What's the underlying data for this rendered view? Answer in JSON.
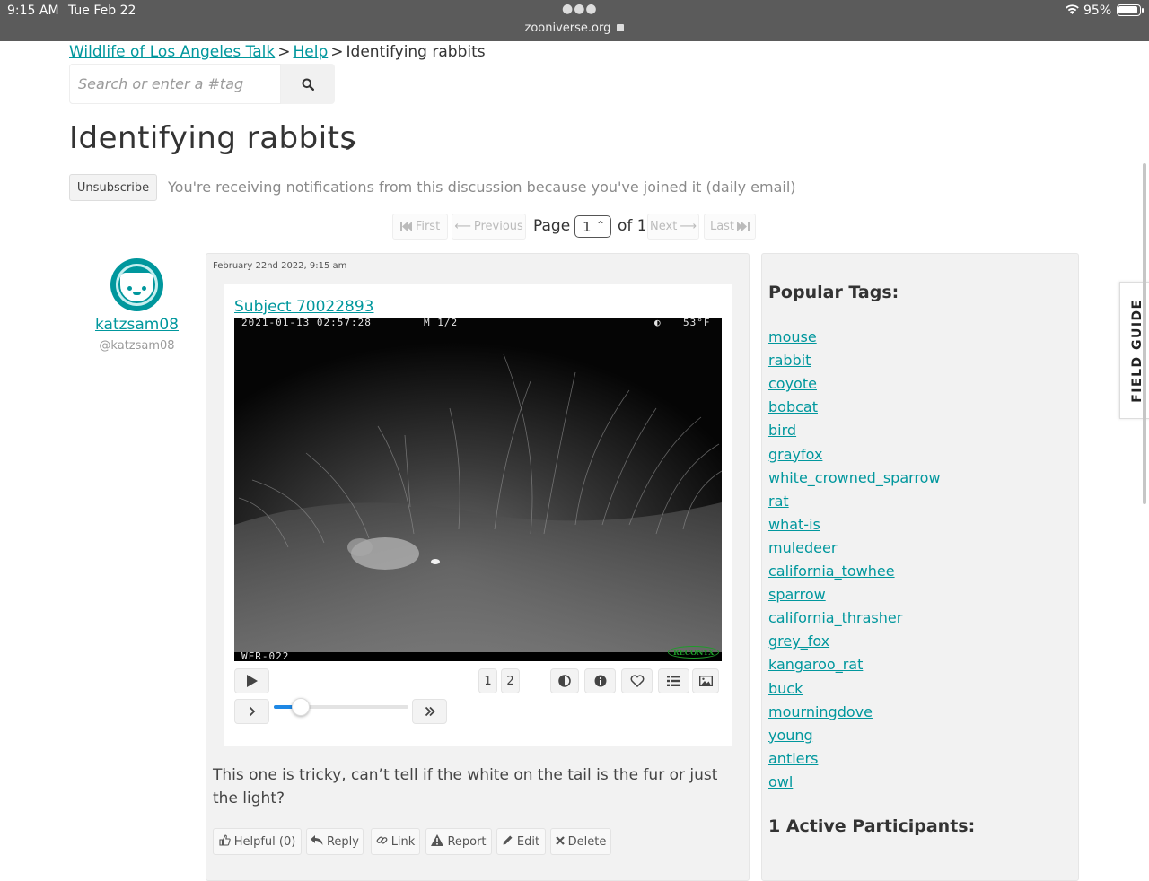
{
  "status_bar": {
    "time": "9:15 AM",
    "date": "Tue Feb 22",
    "url": "zooniverse.org",
    "battery": "95%"
  },
  "breadcrumb": {
    "project": "Wildlife of Los Angeles Talk",
    "board": "Help",
    "current": "Identifying rabbits",
    "separator": ">"
  },
  "search": {
    "placeholder": "Search or enter a #tag",
    "icon": "search-icon"
  },
  "discussion": {
    "title": "Identifying rabbits",
    "unsubscribe_label": "Unsubscribe",
    "notification_text": "You're receiving notifications from this discussion because you've joined it (daily email)"
  },
  "pagination": {
    "first": "First",
    "previous": "Previous",
    "page_label": "Page",
    "current_page": "1",
    "of_label": "of 1",
    "next": "Next",
    "last": "Last"
  },
  "comment": {
    "author_name": "katzsam08",
    "author_login": "@katzsam08",
    "date": "February 22nd 2022, 9:15 am",
    "subject_link": "Subject 70022893",
    "camera_overlay": {
      "timestamp": "2021-01-13 02:57:28",
      "mode": "M 1/2",
      "temperature": "53°F",
      "camera_id": "WFR-022",
      "brand": "RECONYX"
    },
    "frames": [
      "1",
      "2"
    ],
    "body": "This one is tricky, can’t tell if the white on the tail is the fur or just the light?",
    "actions": {
      "helpful": "Helpful (0)",
      "reply": "Reply",
      "link": "Link",
      "report": "Report",
      "edit": "Edit",
      "delete": "Delete"
    }
  },
  "player": {
    "frame_progress": 0.2
  },
  "sidebar": {
    "popular_tags_heading": "Popular Tags:",
    "tags": [
      "mouse",
      "rabbit",
      "coyote",
      "bobcat",
      "bird",
      "grayfox",
      "white_crowned_sparrow",
      "rat",
      "what-is",
      "muledeer",
      "california_towhee",
      "sparrow",
      "california_thrasher",
      "grey_fox",
      "kangaroo_rat",
      "buck",
      "mourningdove",
      "young",
      "antlers",
      "owl"
    ],
    "participants_heading": "1 Active Participants:"
  },
  "field_guide_label": "FIELD GUIDE",
  "colors": {
    "accent": "#00979d",
    "slider": "#1e88e5"
  }
}
